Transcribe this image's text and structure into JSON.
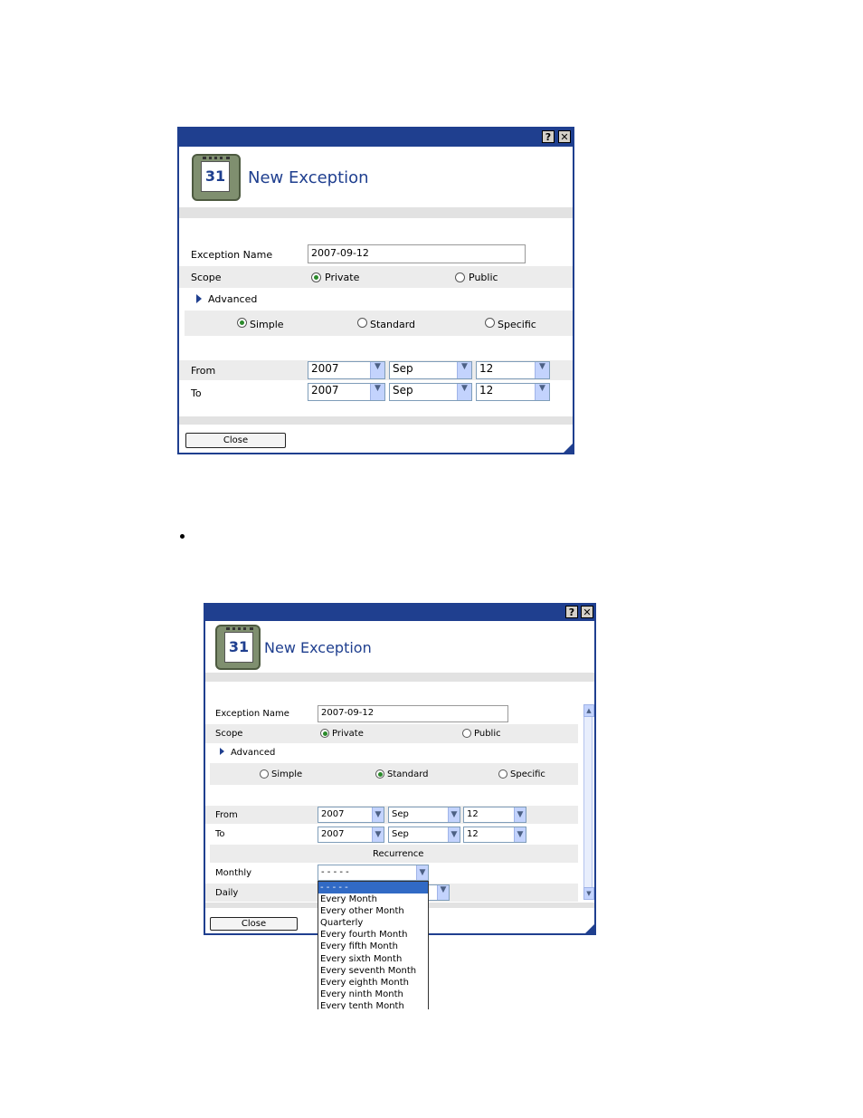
{
  "dialog1": {
    "title": "New Exception",
    "help_btn": "?",
    "close_btn": "✕",
    "icon_day": "31",
    "exception_name_label": "Exception Name",
    "exception_name_value": "2007-09-12",
    "scope_label": "Scope",
    "private_label": "Private",
    "public_label": "Public",
    "advanced_label": "Advanced",
    "simple_label": "Simple",
    "standard_label": "Standard",
    "specific_label": "Specific",
    "from_label": "From",
    "to_label": "To",
    "from_year": "2007",
    "from_month": "Sep",
    "from_day": "12",
    "to_year": "2007",
    "to_month": "Sep",
    "to_day": "12",
    "close_label": "Close"
  },
  "dialog2": {
    "title": "New Exception",
    "help_btn": "?",
    "close_btn": "✕",
    "icon_day": "31",
    "exception_name_label": "Exception Name",
    "exception_name_value": "2007-09-12",
    "scope_label": "Scope",
    "private_label": "Private",
    "public_label": "Public",
    "advanced_label": "Advanced",
    "simple_label": "Simple",
    "standard_label": "Standard",
    "specific_label": "Specific",
    "from_label": "From",
    "to_label": "To",
    "from_year": "2007",
    "from_month": "Sep",
    "from_day": "12",
    "to_year": "2007",
    "to_month": "Sep",
    "to_day": "12",
    "recurrence_label": "Recurrence",
    "monthly_label": "Monthly",
    "monthly_value": "- - - - -",
    "daily_label": "Daily",
    "close_label": "Close",
    "monthly_options": [
      "- - - - -",
      "Every Month",
      "Every other Month",
      "Quarterly",
      "Every fourth Month",
      "Every fifth Month",
      "Every sixth Month",
      "Every seventh Month",
      "Every eighth Month",
      "Every ninth Month",
      "Every tenth Month"
    ]
  },
  "colors": {
    "titlebar": "#1f3f8f",
    "title_text": "#1f3f8f",
    "selected_option": "#316ac5"
  }
}
